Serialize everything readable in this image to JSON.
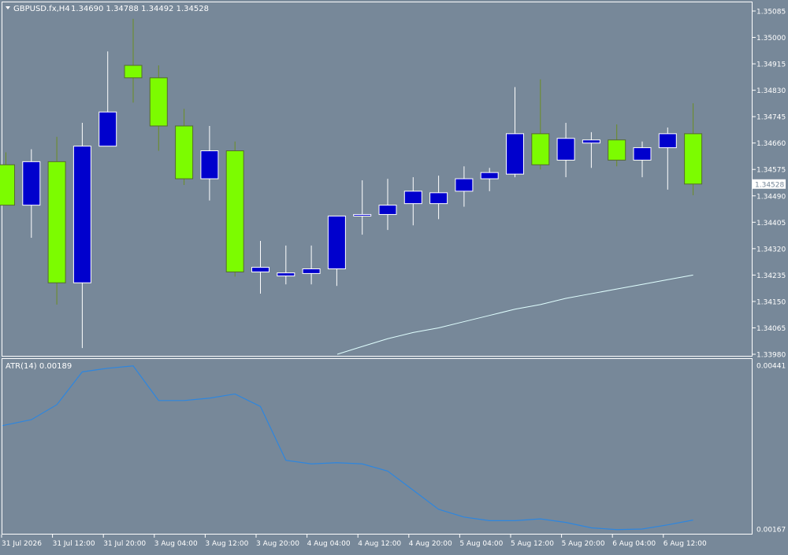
{
  "header": {
    "menu_icon": "triangle-down-icon",
    "symbol": "GBPUSD.fx,H4",
    "ohlc": "1.34690 1.34788 1.34492 1.34528"
  },
  "atr": {
    "label": "ATR(14) 0.00189",
    "ylim": [
      0.00167,
      0.00441
    ],
    "ticks": [
      "0.00441",
      "0.00167"
    ],
    "color": "#2E86DE",
    "values": [
      0.0034,
      0.0035,
      0.00375,
      0.0043,
      0.00436,
      0.0044,
      0.00382,
      0.00382,
      0.00386,
      0.00393,
      0.00372,
      0.00282,
      0.00276,
      0.00278,
      0.00276,
      0.00264,
      0.00232,
      0.002,
      0.00187,
      0.00181,
      0.00181,
      0.00184,
      0.00178,
      0.00169,
      0.00166,
      0.00167,
      0.00174,
      0.00182
    ]
  },
  "colors": {
    "background": "#778899",
    "bull": "#7CFC00",
    "bear": "#0000CD",
    "bull_outline": "#556B2F",
    "bear_outline": "#FFFFFF",
    "bull_wick": "#6B8E23",
    "bear_wick": "#FFFFFF",
    "ma": "#E0FFFF",
    "axis_text": "#FFFFFF",
    "price_tag_bg": "#FFFFFF",
    "price_tag_text": "#778899"
  },
  "chart_data": {
    "type": "candlestick",
    "symbol": "GBPUSD.fx",
    "timeframe": "H4",
    "ylim": [
      1.3398,
      1.35085
    ],
    "y_ticks": [
      "1.35085",
      "1.35000",
      "1.34915",
      "1.34830",
      "1.34745",
      "1.34660",
      "1.34575",
      "1.34490",
      "1.34405",
      "1.34320",
      "1.34235",
      "1.34150",
      "1.34065",
      "1.33980"
    ],
    "current_price": "1.34528",
    "x_labels": [
      "31 Jul 2026",
      "31 Jul 12:00",
      "31 Jul 20:00",
      "3 Aug 04:00",
      "3 Aug 12:00",
      "3 Aug 20:00",
      "4 Aug 04:00",
      "4 Aug 12:00",
      "4 Aug 20:00",
      "5 Aug 04:00",
      "5 Aug 12:00",
      "5 Aug 20:00",
      "6 Aug 04:00",
      "6 Aug 12:00"
    ],
    "candles": [
      {
        "o": 1.3459,
        "h": 1.3463,
        "l": 1.3446,
        "c": 1.3446
      },
      {
        "o": 1.3446,
        "h": 1.3464,
        "l": 1.34355,
        "c": 1.346
      },
      {
        "o": 1.346,
        "h": 1.3468,
        "l": 1.3414,
        "c": 1.3421
      },
      {
        "o": 1.3421,
        "h": 1.34725,
        "l": 1.34,
        "c": 1.3465
      },
      {
        "o": 1.3465,
        "h": 1.34955,
        "l": 1.3465,
        "c": 1.3476
      },
      {
        "o": 1.3491,
        "h": 1.3506,
        "l": 1.3479,
        "c": 1.3487
      },
      {
        "o": 1.3487,
        "h": 1.3491,
        "l": 1.34635,
        "c": 1.34715
      },
      {
        "o": 1.34715,
        "h": 1.3477,
        "l": 1.34525,
        "c": 1.34545
      },
      {
        "o": 1.34545,
        "h": 1.34715,
        "l": 1.34475,
        "c": 1.34635
      },
      {
        "o": 1.34635,
        "h": 1.34665,
        "l": 1.3423,
        "c": 1.34245
      },
      {
        "o": 1.34245,
        "h": 1.34345,
        "l": 1.34175,
        "c": 1.3426
      },
      {
        "o": 1.34232,
        "h": 1.3433,
        "l": 1.34205,
        "c": 1.34242
      },
      {
        "o": 1.3424,
        "h": 1.3433,
        "l": 1.34205,
        "c": 1.34255
      },
      {
        "o": 1.34255,
        "h": 1.34425,
        "l": 1.342,
        "c": 1.34425
      },
      {
        "o": 1.34425,
        "h": 1.3454,
        "l": 1.34365,
        "c": 1.3443
      },
      {
        "o": 1.3443,
        "h": 1.34545,
        "l": 1.3438,
        "c": 1.3446
      },
      {
        "o": 1.34465,
        "h": 1.3455,
        "l": 1.34395,
        "c": 1.34505
      },
      {
        "o": 1.34465,
        "h": 1.34555,
        "l": 1.34415,
        "c": 1.345
      },
      {
        "o": 1.34505,
        "h": 1.34585,
        "l": 1.34455,
        "c": 1.34545
      },
      {
        "o": 1.34545,
        "h": 1.3458,
        "l": 1.34505,
        "c": 1.34565
      },
      {
        "o": 1.3456,
        "h": 1.3484,
        "l": 1.3455,
        "c": 1.3469
      },
      {
        "o": 1.3469,
        "h": 1.34865,
        "l": 1.34575,
        "c": 1.3459
      },
      {
        "o": 1.34605,
        "h": 1.34725,
        "l": 1.3455,
        "c": 1.34675
      },
      {
        "o": 1.3466,
        "h": 1.34695,
        "l": 1.3458,
        "c": 1.3467
      },
      {
        "o": 1.3467,
        "h": 1.3472,
        "l": 1.34585,
        "c": 1.34605
      },
      {
        "o": 1.34605,
        "h": 1.34665,
        "l": 1.3455,
        "c": 1.34645
      },
      {
        "o": 1.34645,
        "h": 1.3471,
        "l": 1.3451,
        "c": 1.3469
      },
      {
        "o": 1.3469,
        "h": 1.34788,
        "l": 1.34492,
        "c": 1.34528
      }
    ],
    "moving_average": [
      null,
      null,
      null,
      null,
      null,
      null,
      null,
      null,
      null,
      null,
      null,
      null,
      null,
      1.3398,
      1.34005,
      1.3403,
      1.3405,
      1.34065,
      1.34085,
      1.34105,
      1.34125,
      1.3414,
      1.3416,
      1.34175,
      1.3419,
      1.34205,
      1.3422,
      1.34235
    ]
  }
}
